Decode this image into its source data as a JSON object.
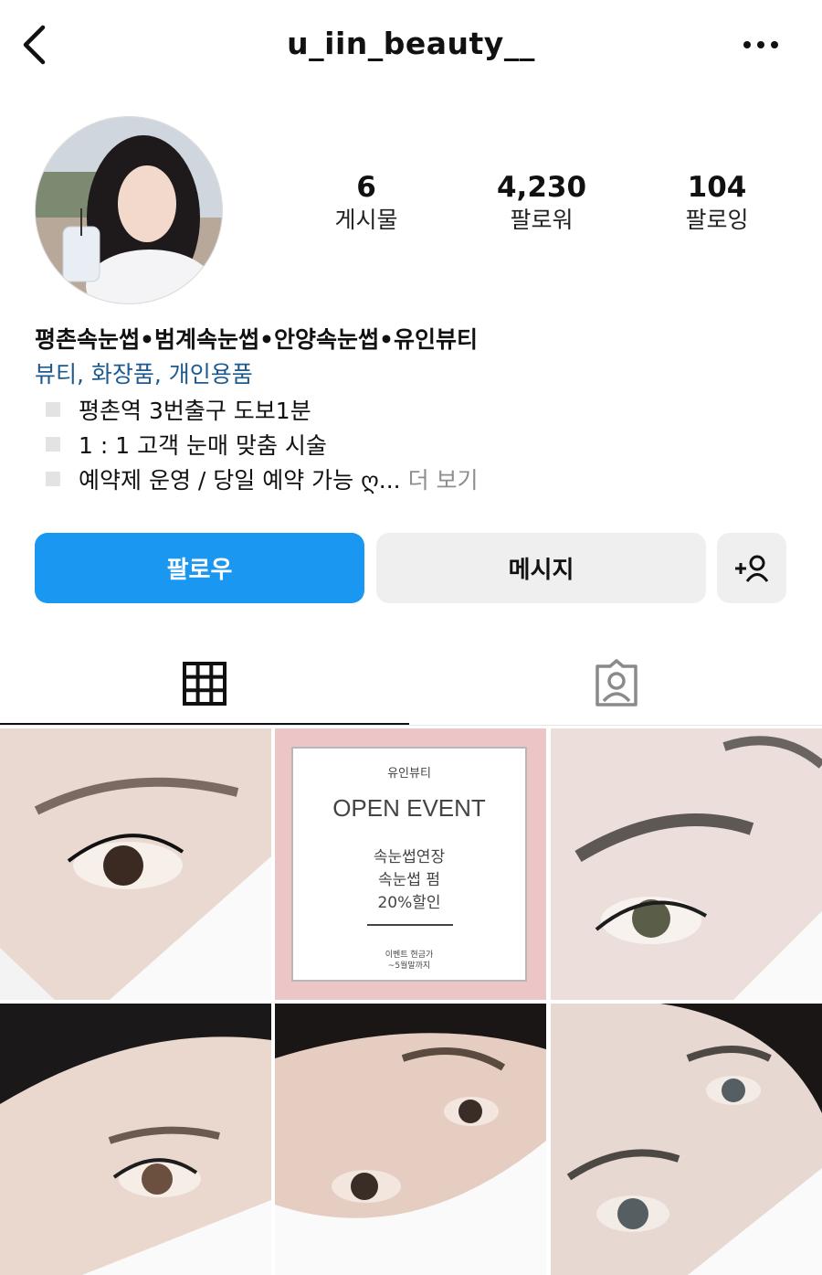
{
  "header": {
    "username": "u_iin_beauty__",
    "back_icon": "chevron-left-icon",
    "more_icon": "more-horizontal-icon"
  },
  "stats": {
    "posts": {
      "value": "6",
      "label": "게시물"
    },
    "followers": {
      "value": "4,230",
      "label": "팔로워"
    },
    "following": {
      "value": "104",
      "label": "팔로잉"
    }
  },
  "bio": {
    "name": "평촌속눈썹•범계속눈썹•안양속눈썹•유인뷰티",
    "category": "뷰티, 화장품, 개인용품",
    "lines": [
      "평촌역 3번출구 도보1분",
      "1 : 1 고객 눈매 맞춤 시술",
      "예약제 운영 / 당일 예약 가능 ღ..."
    ],
    "more_label": "더 보기"
  },
  "actions": {
    "follow_label": "팔로우",
    "message_label": "메시지",
    "add_user_icon": "add-person-icon"
  },
  "tabs": {
    "grid_icon": "grid-icon",
    "tagged_icon": "tagged-person-icon"
  },
  "event_post": {
    "brand": "유인뷰티",
    "headline": "OPEN EVENT",
    "line1": "속눈썹연장",
    "line2": "속눈썹 펌",
    "line3": "20%할인",
    "footnote1": "이벤트 현금가",
    "footnote2": "~5월말까지"
  },
  "colors": {
    "follow_button": "#1a97f0",
    "secondary_button": "#efefef",
    "category_link": "#1c5a8f",
    "event_bg": "#ecc6c6"
  }
}
